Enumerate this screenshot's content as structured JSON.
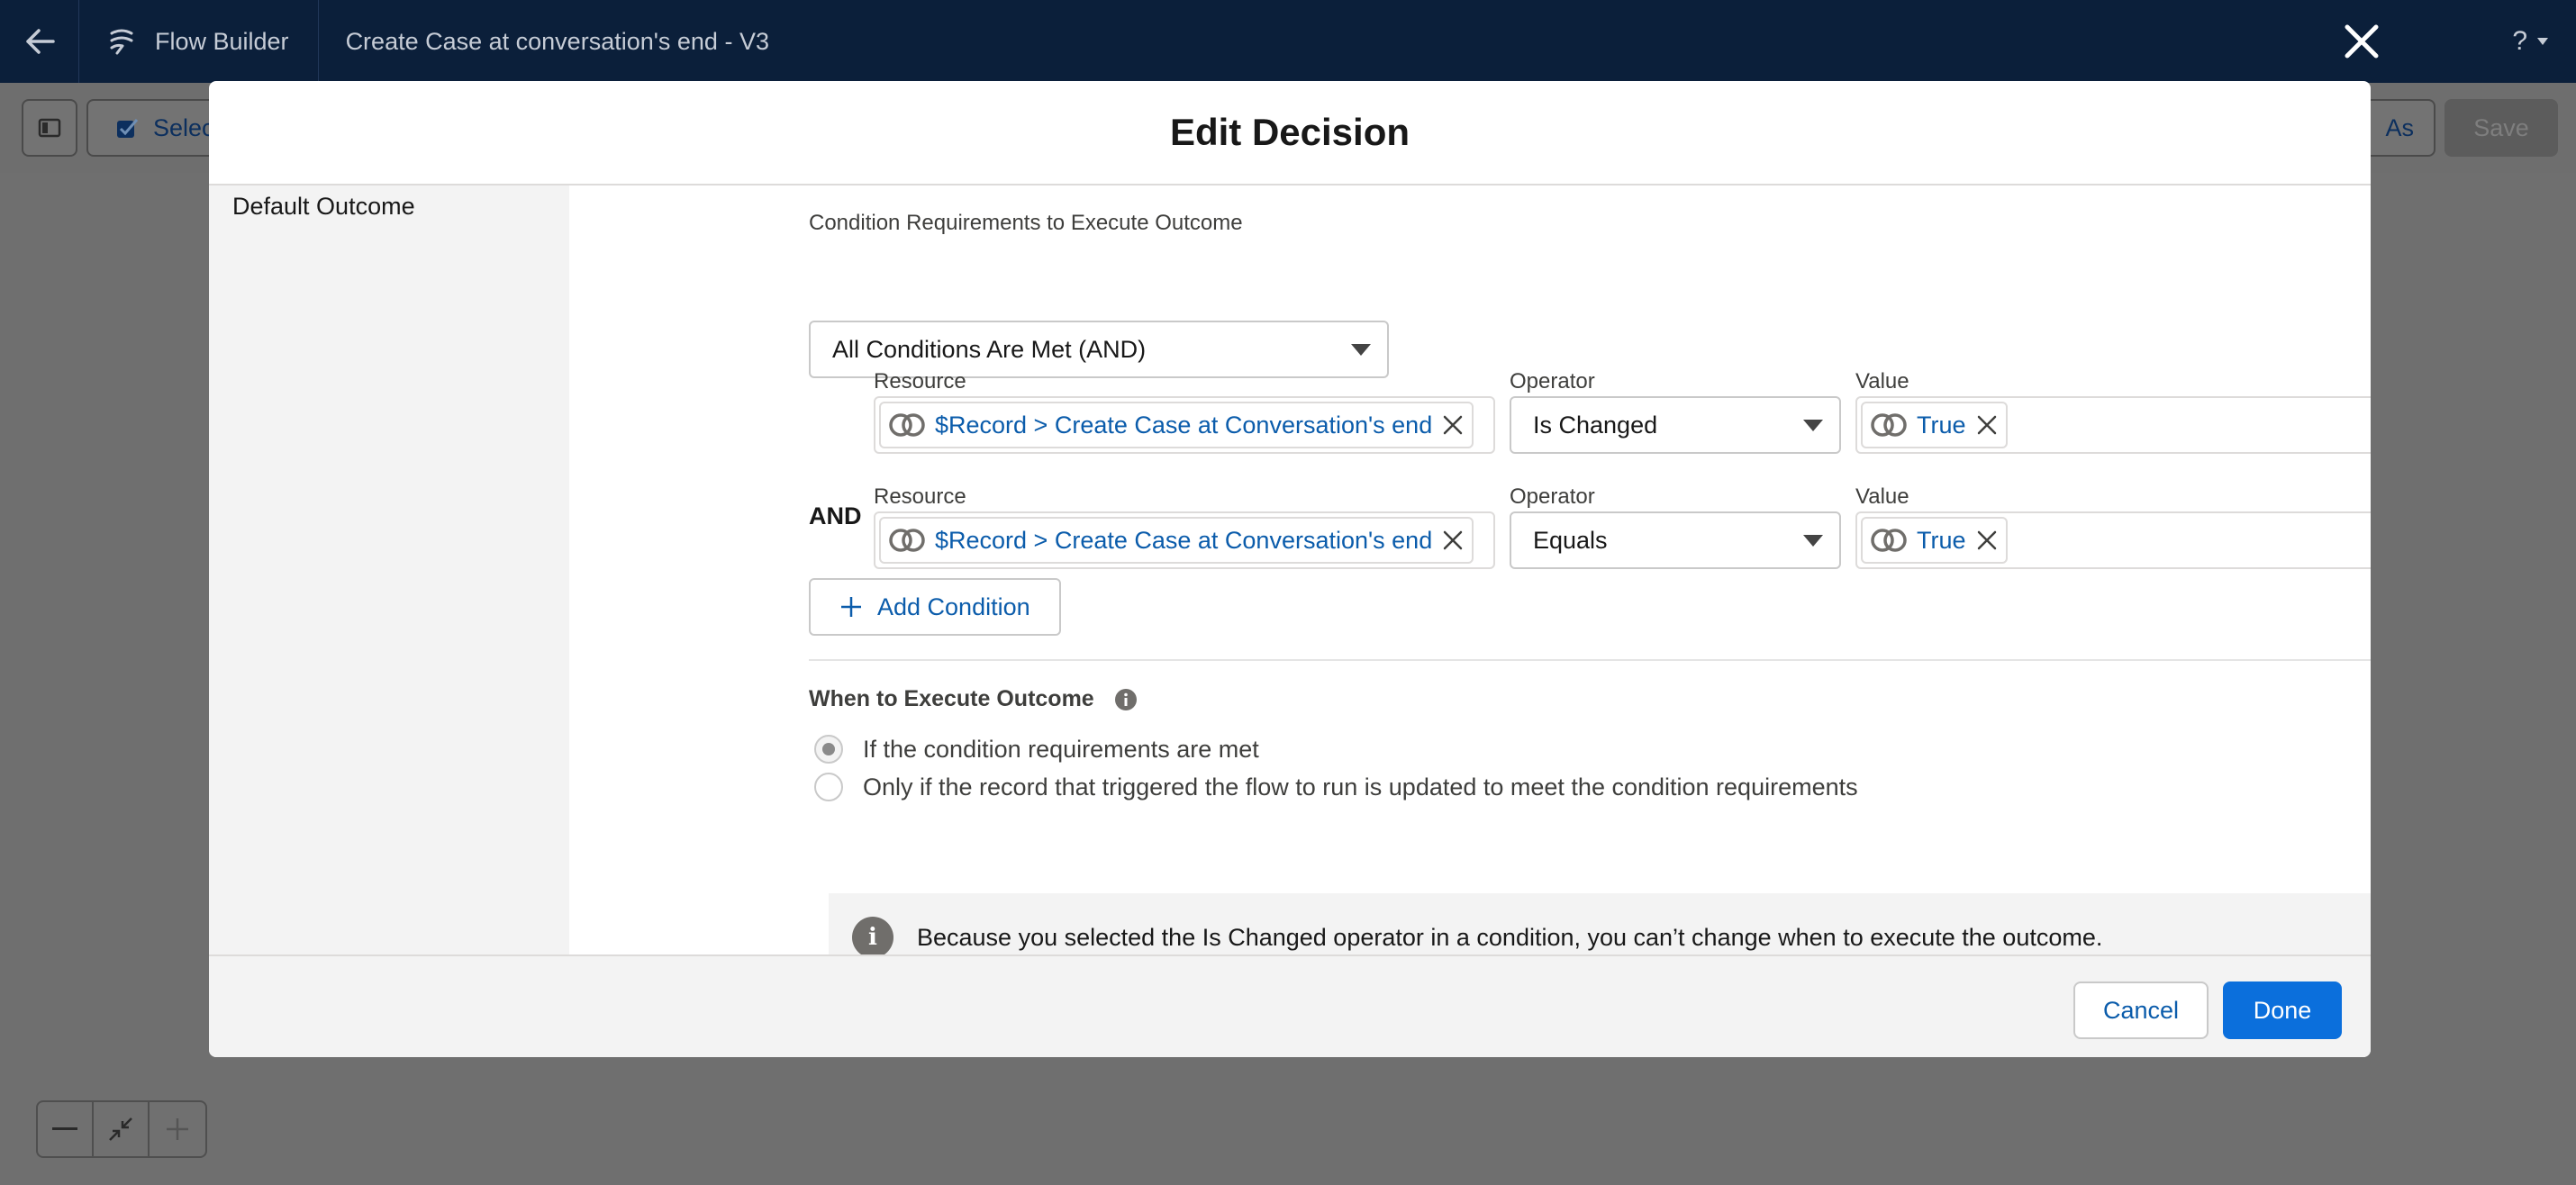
{
  "header": {
    "app_name": "Flow Builder",
    "flow_name": "Create Case at conversation's end - V3",
    "help_label": "?"
  },
  "toolbar": {
    "select_label": "Selec",
    "save_as_label": "As",
    "save_label": "Save"
  },
  "modal": {
    "title": "Edit Decision",
    "left_items": [
      "Default Outcome"
    ],
    "condition_requirements": {
      "label": "Condition Requirements to Execute Outcome",
      "value": "All Conditions Are Met (AND)"
    },
    "conditions": [
      {
        "logic": "",
        "resource_label": "Resource",
        "resource": "$Record > Create Case at Conversation's end",
        "operator_label": "Operator",
        "operator": "Is Changed",
        "value_label": "Value",
        "value": "True"
      },
      {
        "logic": "AND",
        "resource_label": "Resource",
        "resource": "$Record > Create Case at Conversation's end",
        "operator_label": "Operator",
        "operator": "Equals",
        "value_label": "Value",
        "value": "True"
      }
    ],
    "add_condition_label": "Add Condition",
    "when_to_execute": {
      "title": "When to Execute Outcome",
      "options": [
        "If the condition requirements are met",
        "Only if the record that triggered the flow to run is updated to meet the condition requirements"
      ],
      "selected_index": 0
    },
    "notice": "Because you selected the Is Changed operator in a condition, you can’t change when to execute the outcome.",
    "cancel_label": "Cancel",
    "done_label": "Done"
  },
  "colors": {
    "header_bg": "#0b1f3a",
    "link_blue": "#0b5cab",
    "brand_button": "#0b6fdc"
  }
}
